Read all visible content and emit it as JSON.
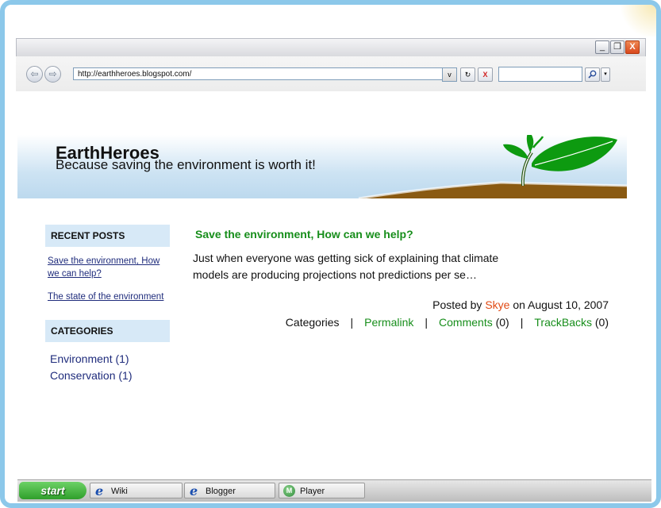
{
  "browser": {
    "url": "http://earthheroes.blogspot.com/",
    "window_buttons": [
      "_",
      "❐",
      "X"
    ],
    "dropdown_glyph": "v",
    "refresh_glyph": "↻",
    "stop_glyph": "X",
    "search_value": ""
  },
  "site": {
    "title": "EarthHeroes",
    "tagline": "Because saving the environment is worth it!"
  },
  "sidebar": {
    "recent_heading": "RECENT POSTS",
    "recent_posts": [
      "Save the environment, How we can help?",
      "The state of the environment"
    ],
    "categories_heading": "CATEGORIES",
    "categories": [
      "Environment (1)",
      "Conservation (1)"
    ]
  },
  "post": {
    "title": "Save the environment, How can we help?",
    "body": "Just when everyone was getting sick of explaining that climate models are producing projections not predictions per se…",
    "posted_by_prefix": "Posted by",
    "author": "Skye",
    "date_text": "on August 10, 2007",
    "categories_label": "Categories",
    "permalink_label": "Permalink",
    "comments_label": "Comments",
    "comments_count": "(0)",
    "trackbacks_label": "TrackBacks",
    "trackbacks_count": "(0)",
    "separator": "|"
  },
  "taskbar": {
    "start_label": "start",
    "items": [
      {
        "label": "Wiki",
        "icon": "internet-explorer-icon"
      },
      {
        "label": "Blogger",
        "icon": "internet-explorer-icon"
      },
      {
        "label": "Player",
        "icon": "media-player-icon"
      }
    ],
    "ie_glyph": "e",
    "player_glyph": "M"
  },
  "colors": {
    "frame_border": "#8cc8ea",
    "accent_green": "#178e1b",
    "author_red": "#e14a14",
    "link_blue": "#1f2c7c",
    "sidebar_heading_bg": "#d7e9f7",
    "leaf_green": "#0d9a10",
    "soil_brown": "#8a5a12"
  }
}
